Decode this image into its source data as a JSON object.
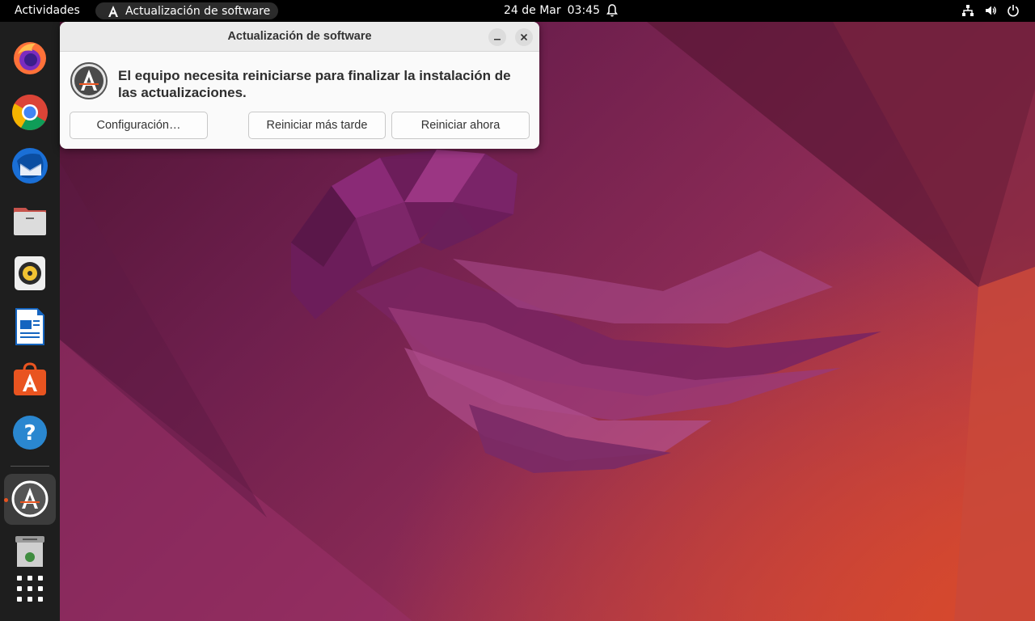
{
  "topbar": {
    "activities": "Actividades",
    "app_name": "Actualización de software",
    "date": "24 de Mar",
    "time": "03:45"
  },
  "dock": {
    "items": [
      {
        "name": "firefox-icon"
      },
      {
        "name": "chrome-icon"
      },
      {
        "name": "thunderbird-icon"
      },
      {
        "name": "files-icon"
      },
      {
        "name": "rhythmbox-icon"
      },
      {
        "name": "libreoffice-writer-icon"
      },
      {
        "name": "ubuntu-software-icon"
      },
      {
        "name": "help-icon"
      },
      {
        "name": "software-updater-icon"
      },
      {
        "name": "trash-icon"
      },
      {
        "name": "show-apps-icon"
      }
    ],
    "accent": "#e95420"
  },
  "dialog": {
    "title": "Actualización de software",
    "message": "El equipo necesita reiniciarse para finalizar la instalación de las actualizaciones.",
    "buttons": {
      "settings": "Configuración…",
      "restart_later": "Reiniciar más tarde",
      "restart_now": "Reiniciar ahora"
    }
  },
  "colors": {
    "topbar": "#000000",
    "dock": "#1e1e1e",
    "dialog_bg": "#fafafa",
    "ubuntu_orange": "#e95420"
  }
}
